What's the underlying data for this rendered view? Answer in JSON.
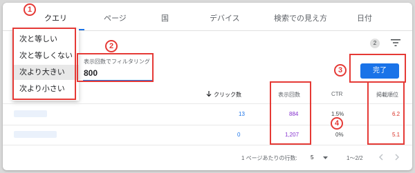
{
  "tabs": [
    "クエリ",
    "ページ",
    "国",
    "デバイス",
    "検索での見え方",
    "日付"
  ],
  "menu": {
    "items": [
      "次と等しい",
      "次と等しくない",
      "次より大きい",
      "次より小さい"
    ],
    "selected_index": 2
  },
  "filter": {
    "label": "表示回数でフィルタリング",
    "value": "800"
  },
  "toolbar": {
    "badge_count": "2"
  },
  "done_button": {
    "label": "完了"
  },
  "table": {
    "headers": {
      "clicks": "クリック数",
      "impressions": "表示回数",
      "ctr": "CTR",
      "position": "掲載順位"
    },
    "rows": [
      {
        "clicks": "13",
        "impressions": "884",
        "ctr": "1.5%",
        "position": "6.2"
      },
      {
        "clicks": "0",
        "impressions": "1,207",
        "ctr": "0%",
        "position": "5.1"
      }
    ]
  },
  "pagination": {
    "rows_per_page_label": "1 ページあたりの行数:",
    "rows_per_page_value": "5",
    "range": "1〜2/2"
  },
  "annotations": [
    "1",
    "2",
    "3",
    "4"
  ],
  "colors": {
    "accent": "#1a73e8",
    "annotation": "#e53935",
    "impressions": "#8430ce",
    "position": "#d93025"
  },
  "icons": [
    "filter-icon",
    "sort-arrow-down-icon",
    "dropdown-arrow-icon",
    "chevron-left-icon",
    "chevron-right-icon"
  ]
}
